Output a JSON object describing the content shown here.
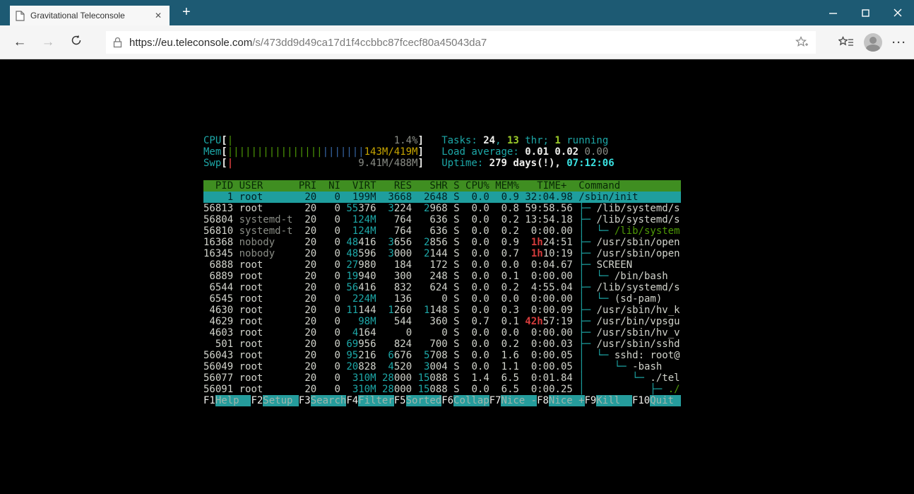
{
  "browser": {
    "tab": {
      "title": "Gravitational Teleconsole"
    },
    "newtab_label": "+",
    "url": {
      "origin": "https://eu.teleconsole.com",
      "path": "/s/473dd9d49ca17d1f4ccbbc87fcecf80a45043da7"
    },
    "colors": {
      "tabbar": "#1d5a73",
      "toolbar": "#f5f5f5"
    }
  },
  "terminal": {
    "palette": {
      "fg": "#d2d4cc",
      "cyan": "#1da8a8",
      "bright_cyan": "#3ae2e2",
      "green": "#4e9a06",
      "bright_green": "#9ccc2a",
      "blue": "#3868a8",
      "yellow": "#c7a500",
      "red": "#d63c3c",
      "dim": "#8a8d86",
      "header_bg": "#3f8e21",
      "selected_bg": "#1f9e9e",
      "fkey_bg": "#259c9c"
    },
    "meters": [
      {
        "label": "CPU",
        "inner": 32,
        "ticks": [
          {
            "count": 1,
            "color": "green"
          }
        ],
        "text": "1.4%",
        "text_color": "dim"
      },
      {
        "label": "Mem",
        "inner": 32,
        "ticks": [
          {
            "count": 16,
            "color": "green"
          },
          {
            "count": 7,
            "color": "blue"
          }
        ],
        "text": "143M/419M",
        "text_color": "yellow"
      },
      {
        "label": "Swp",
        "inner": 32,
        "ticks": [
          {
            "count": 1,
            "color": "red"
          }
        ],
        "text": "9.41M/488M",
        "text_color": "dim"
      }
    ],
    "summary": [
      {
        "segments": [
          [
            "Tasks: ",
            "cyan"
          ],
          [
            "24",
            "boldw"
          ],
          [
            ", ",
            "cyan"
          ],
          [
            "13",
            "bgreen"
          ],
          [
            " thr; ",
            "cyan"
          ],
          [
            "1",
            "bgreen"
          ],
          [
            " running",
            "cyan"
          ]
        ]
      },
      {
        "segments": [
          [
            "Load average: ",
            "cyan"
          ],
          [
            "0.01 ",
            "boldw"
          ],
          [
            "0.02 ",
            "boldw"
          ],
          [
            "0.00",
            "dim"
          ]
        ]
      },
      {
        "segments": [
          [
            "Uptime: ",
            "cyan"
          ],
          [
            "279 days(!), ",
            "boldw"
          ],
          [
            "07:12:06",
            "bcyan"
          ]
        ]
      }
    ],
    "table": {
      "header": {
        "pid": "PID",
        "user": "USER",
        "pri": "PRI",
        "ni": "NI",
        "virt": "VIRT",
        "res": "RES",
        "shr": "SHR",
        "s": "S",
        "cpu": "CPU%",
        "mem": "MEM%",
        "time": "  TIME+ ",
        "cmd": "Command"
      },
      "rows": [
        {
          "sel": true,
          "pid": "1",
          "user": "root",
          "pri": "20",
          "ni": "0",
          "virt": [
            [
              "199M",
              "cyan"
            ]
          ],
          "res": "3668",
          "shr": "2648",
          "s": "S",
          "cpu": "0.0",
          "mem": "0.9",
          "time": [
            [
              "32:04.98",
              "fg"
            ]
          ],
          "tree": "",
          "cmd": "/sbin/init"
        },
        {
          "pid": "56813",
          "user": "root",
          "pri": "20",
          "ni": "0",
          "virt": [
            [
              "55",
              "cyan"
            ],
            [
              "376",
              "fg"
            ]
          ],
          "res": [
            [
              "3",
              "cyan"
            ],
            [
              "224",
              "fg"
            ]
          ],
          "shr": [
            [
              "2",
              "cyan"
            ],
            [
              "968",
              "fg"
            ]
          ],
          "s": "S",
          "cpu": "0.0",
          "mem": "0.8",
          "time": [
            [
              "59:58.56",
              "fg"
            ]
          ],
          "tree": "├─ ",
          "cmd": "/lib/systemd/s"
        },
        {
          "pid": "56804",
          "user": "systemd-t",
          "userc": "dim",
          "pri": "20",
          "ni": "0",
          "virt": [
            [
              "124M",
              "cyan"
            ]
          ],
          "res": "764",
          "shr": "636",
          "s": "S",
          "cpu": "0.0",
          "mem": "0.2",
          "time": [
            [
              "13:54.18",
              "fg"
            ]
          ],
          "tree": "├─ ",
          "cmd": "/lib/systemd/s"
        },
        {
          "pid": "56810",
          "user": "systemd-t",
          "userc": "dim",
          "pri": "20",
          "ni": "0",
          "virt": [
            [
              "124M",
              "cyan"
            ]
          ],
          "res": "764",
          "shr": "636",
          "s": "S",
          "cpu": "0.0",
          "mem": "0.2",
          "time": [
            [
              "0:00.00",
              "fg"
            ]
          ],
          "tree": "│  └─ ",
          "cmd": "/lib/system",
          "cmdc": "green"
        },
        {
          "pid": "16368",
          "user": "nobody",
          "userc": "dim",
          "pri": "20",
          "ni": "0",
          "virt": [
            [
              "48",
              "cyan"
            ],
            [
              "416",
              "fg"
            ]
          ],
          "res": [
            [
              "3",
              "cyan"
            ],
            [
              "656",
              "fg"
            ]
          ],
          "shr": [
            [
              "2",
              "cyan"
            ],
            [
              "856",
              "fg"
            ]
          ],
          "s": "S",
          "cpu": "0.0",
          "mem": "0.9",
          "time": [
            [
              "1h",
              "red"
            ],
            [
              "24:51",
              "fg"
            ]
          ],
          "tree": "├─ ",
          "cmd": "/usr/sbin/open"
        },
        {
          "pid": "16345",
          "user": "nobody",
          "userc": "dim",
          "pri": "20",
          "ni": "0",
          "virt": [
            [
              "48",
              "cyan"
            ],
            [
              "596",
              "fg"
            ]
          ],
          "res": [
            [
              "3",
              "cyan"
            ],
            [
              "000",
              "fg"
            ]
          ],
          "shr": [
            [
              "2",
              "cyan"
            ],
            [
              "144",
              "fg"
            ]
          ],
          "s": "S",
          "cpu": "0.0",
          "mem": "0.7",
          "time": [
            [
              "1h",
              "red"
            ],
            [
              "10:19",
              "fg"
            ]
          ],
          "tree": "├─ ",
          "cmd": "/usr/sbin/open"
        },
        {
          "pid": "6888",
          "user": "root",
          "pri": "20",
          "ni": "0",
          "virt": [
            [
              "27",
              "cyan"
            ],
            [
              "980",
              "fg"
            ]
          ],
          "res": "184",
          "shr": "172",
          "s": "S",
          "cpu": "0.0",
          "mem": "0.0",
          "time": [
            [
              "0:04.67",
              "fg"
            ]
          ],
          "tree": "├─ ",
          "cmd": "SCREEN"
        },
        {
          "pid": "6889",
          "user": "root",
          "pri": "20",
          "ni": "0",
          "virt": [
            [
              "19",
              "cyan"
            ],
            [
              "940",
              "fg"
            ]
          ],
          "res": "300",
          "shr": "248",
          "s": "S",
          "cpu": "0.0",
          "mem": "0.1",
          "time": [
            [
              "0:00.00",
              "fg"
            ]
          ],
          "tree": "│  └─ ",
          "cmd": "/bin/bash"
        },
        {
          "pid": "6544",
          "user": "root",
          "pri": "20",
          "ni": "0",
          "virt": [
            [
              "56",
              "cyan"
            ],
            [
              "416",
              "fg"
            ]
          ],
          "res": "832",
          "shr": "624",
          "s": "S",
          "cpu": "0.0",
          "mem": "0.2",
          "time": [
            [
              "4:55.04",
              "fg"
            ]
          ],
          "tree": "├─ ",
          "cmd": "/lib/systemd/s"
        },
        {
          "pid": "6545",
          "user": "root",
          "pri": "20",
          "ni": "0",
          "virt": [
            [
              "224M",
              "cyan"
            ]
          ],
          "res": "136",
          "shr": "0",
          "s": "S",
          "cpu": "0.0",
          "mem": "0.0",
          "time": [
            [
              "0:00.00",
              "fg"
            ]
          ],
          "tree": "│  └─ ",
          "cmd": "(sd-pam)"
        },
        {
          "pid": "4630",
          "user": "root",
          "pri": "20",
          "ni": "0",
          "virt": [
            [
              "11",
              "cyan"
            ],
            [
              "144",
              "fg"
            ]
          ],
          "res": [
            [
              "1",
              "cyan"
            ],
            [
              "260",
              "fg"
            ]
          ],
          "shr": [
            [
              "1",
              "cyan"
            ],
            [
              "148",
              "fg"
            ]
          ],
          "s": "S",
          "cpu": "0.0",
          "mem": "0.3",
          "time": [
            [
              "0:00.09",
              "fg"
            ]
          ],
          "tree": "├─ ",
          "cmd": "/usr/sbin/hv_k"
        },
        {
          "pid": "4629",
          "user": "root",
          "pri": "20",
          "ni": "0",
          "virt": [
            [
              "98M",
              "cyan"
            ]
          ],
          "res": "544",
          "shr": "360",
          "s": "S",
          "cpu": "0.7",
          "mem": "0.1",
          "time": [
            [
              "42h",
              "red"
            ],
            [
              "57:19",
              "fg"
            ]
          ],
          "tree": "├─ ",
          "cmd": "/usr/bin/vpsgu"
        },
        {
          "pid": "4603",
          "user": "root",
          "pri": "20",
          "ni": "0",
          "virt": [
            [
              "4",
              "cyan"
            ],
            [
              "164",
              "fg"
            ]
          ],
          "res": "0",
          "shr": "0",
          "s": "S",
          "cpu": "0.0",
          "mem": "0.0",
          "time": [
            [
              "0:00.00",
              "fg"
            ]
          ],
          "tree": "├─ ",
          "cmd": "/usr/sbin/hv_v"
        },
        {
          "pid": "501",
          "user": "root",
          "pri": "20",
          "ni": "0",
          "virt": [
            [
              "69",
              "cyan"
            ],
            [
              "956",
              "fg"
            ]
          ],
          "res": "824",
          "shr": "700",
          "s": "S",
          "cpu": "0.0",
          "mem": "0.2",
          "time": [
            [
              "0:00.03",
              "fg"
            ]
          ],
          "tree": "├─ ",
          "cmd": "/usr/sbin/sshd"
        },
        {
          "pid": "56043",
          "user": "root",
          "pri": "20",
          "ni": "0",
          "virt": [
            [
              "95",
              "cyan"
            ],
            [
              "216",
              "fg"
            ]
          ],
          "res": [
            [
              "6",
              "cyan"
            ],
            [
              "676",
              "fg"
            ]
          ],
          "shr": [
            [
              "5",
              "cyan"
            ],
            [
              "708",
              "fg"
            ]
          ],
          "s": "S",
          "cpu": "0.0",
          "mem": "1.6",
          "time": [
            [
              "0:00.05",
              "fg"
            ]
          ],
          "tree": "│  └─ ",
          "cmd": "sshd: root@"
        },
        {
          "pid": "56049",
          "user": "root",
          "pri": "20",
          "ni": "0",
          "virt": [
            [
              "20",
              "cyan"
            ],
            [
              "828",
              "fg"
            ]
          ],
          "res": [
            [
              "4",
              "cyan"
            ],
            [
              "520",
              "fg"
            ]
          ],
          "shr": [
            [
              "3",
              "cyan"
            ],
            [
              "004",
              "fg"
            ]
          ],
          "s": "S",
          "cpu": "0.0",
          "mem": "1.1",
          "time": [
            [
              "0:00.05",
              "fg"
            ]
          ],
          "tree": "│     └─ ",
          "cmd": "-bash"
        },
        {
          "pid": "56077",
          "user": "root",
          "pri": "20",
          "ni": "0",
          "virt": [
            [
              "310M",
              "cyan"
            ]
          ],
          "res": [
            [
              "28",
              "cyan"
            ],
            [
              "000",
              "fg"
            ]
          ],
          "shr": [
            [
              "15",
              "cyan"
            ],
            [
              "088",
              "fg"
            ]
          ],
          "s": "S",
          "cpu": "1.4",
          "mem": "6.5",
          "time": [
            [
              "0:01.84",
              "fg"
            ]
          ],
          "tree": "│        └─ ",
          "cmd": "./tel"
        },
        {
          "pid": "56091",
          "user": "root",
          "pri": "20",
          "ni": "0",
          "virt": [
            [
              "310M",
              "cyan"
            ]
          ],
          "res": [
            [
              "28",
              "cyan"
            ],
            [
              "000",
              "fg"
            ]
          ],
          "shr": [
            [
              "15",
              "cyan"
            ],
            [
              "088",
              "fg"
            ]
          ],
          "s": "S",
          "cpu": "0.0",
          "mem": "6.5",
          "time": [
            [
              "0:00.25",
              "fg"
            ]
          ],
          "tree": "│           ├─ ",
          "cmd": "./",
          "cmdc": "green"
        }
      ]
    },
    "fkeys": [
      {
        "key": "F1",
        "label": "Help"
      },
      {
        "key": "F2",
        "label": "Setup"
      },
      {
        "key": "F3",
        "label": "Search"
      },
      {
        "key": "F4",
        "label": "Filter"
      },
      {
        "key": "F5",
        "label": "Sorted"
      },
      {
        "key": "F6",
        "label": "Collap"
      },
      {
        "key": "F7",
        "label": "Nice -"
      },
      {
        "key": "F8",
        "label": "Nice +"
      },
      {
        "key": "F9",
        "label": "Kill"
      },
      {
        "key": "F10",
        "label": "Quit"
      }
    ]
  }
}
